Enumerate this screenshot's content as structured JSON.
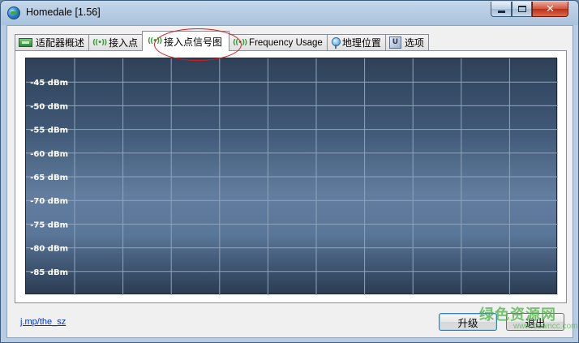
{
  "window": {
    "title": "Homedale [1.56]",
    "close_glyph": "✕"
  },
  "tabs": [
    {
      "label": "适配器概述",
      "icon": "network-adapter-icon",
      "active": false
    },
    {
      "label": "接入点",
      "icon": "wireless-signal-icon",
      "active": false
    },
    {
      "label": "接入点信号图",
      "icon": "wireless-signal-icon",
      "active": true
    },
    {
      "label": "Frequency Usage",
      "icon": "wireless-signal-icon",
      "active": false
    },
    {
      "label": "地理位置",
      "icon": "map-pin-icon",
      "active": false
    },
    {
      "label": "选项",
      "icon": "options-icon",
      "active": false
    }
  ],
  "chart_data": {
    "type": "line",
    "ylabel_ticks": [
      "-45 dBm",
      "-50 dBm",
      "-55 dBm",
      "-60 dBm",
      "-65 dBm",
      "-70 dBm",
      "-75 dBm",
      "-80 dBm",
      "-85 dBm"
    ],
    "y_values": [
      -45,
      -50,
      -55,
      -60,
      -65,
      -70,
      -75,
      -80,
      -85
    ],
    "ylim": [
      -90,
      -40
    ],
    "x_divisions": 11,
    "grid": true,
    "series": [],
    "colors": {
      "grid": "#8fa4bd",
      "label": "#ffffff"
    }
  },
  "footer": {
    "link": "j.mp/the_sz",
    "upgrade_label": "升级",
    "exit_label": "退出"
  },
  "watermark": {
    "text": "绿色资源网",
    "url": "www.downcc.com"
  },
  "colors": {
    "accent_circle": "#d21c1c",
    "close_button": "#c93a22"
  }
}
